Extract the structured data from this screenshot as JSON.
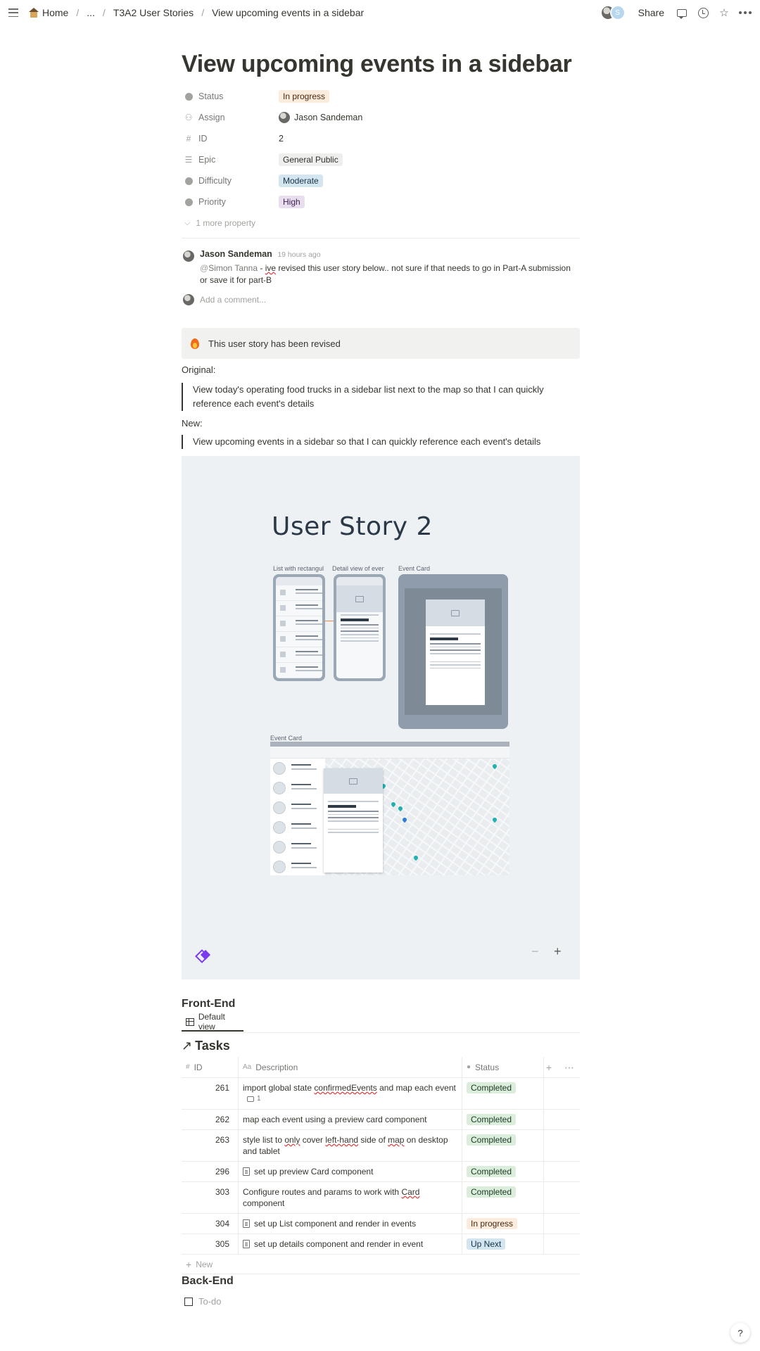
{
  "breadcrumb": {
    "home": "Home",
    "ellipsis": "...",
    "parent": "T3A2 User Stories",
    "current": "View upcoming events in a sidebar"
  },
  "topbar": {
    "share_label": "Share",
    "avatar2_initial": "S"
  },
  "page": {
    "title": "View upcoming events in a sidebar"
  },
  "properties": [
    {
      "icon": "status-icon",
      "name": "Status",
      "value": "In progress",
      "color": "#fbecdd"
    },
    {
      "icon": "person-icon",
      "name": "Assign",
      "value": "Jason Sandeman"
    },
    {
      "icon": "hash-icon",
      "name": "ID",
      "value": "2"
    },
    {
      "icon": "list-icon",
      "name": "Epic",
      "value": "General Public",
      "color": "#eeeeec"
    },
    {
      "icon": "select-icon",
      "name": "Difficulty",
      "value": "Moderate",
      "color": "#d3e5ef"
    },
    {
      "icon": "select-icon",
      "name": "Priority",
      "value": "High",
      "color": "#e8deee"
    }
  ],
  "more_property": "1 more property",
  "comment": {
    "author": "Jason Sandeman",
    "time": "19 hours ago",
    "mention": "Simon Tanna",
    "dash": " - ",
    "misspelled": "ive",
    "text": " revised this user story below.. not sure if that needs to go in Part-A submission or save it for part-B",
    "add_placeholder": "Add a comment..."
  },
  "callout": {
    "text": "This user story has been revised"
  },
  "original_label": "Original:",
  "original_quote": "View today's operating food trucks in a sidebar list next to the map so that I can quickly reference each event's details",
  "new_label": "New:",
  "new_quote": "View upcoming events in a sidebar so that I can quickly reference each event's details",
  "embed": {
    "title": "User Story 2",
    "frame_list": "List with rectangular",
    "frame_detail": "Detail view of event",
    "frame_event_card": "Event Card",
    "frame_event_card_web": "Event Card",
    "zoom_out": "−",
    "zoom_in": "+"
  },
  "frontend": {
    "heading": "Front-End",
    "view_label": "Default view",
    "db_title": "Tasks",
    "columns": {
      "id": "ID",
      "description": "Description",
      "status": "Status"
    },
    "rows": [
      {
        "id": "261",
        "description": "import global state confirmedEvents and map each event",
        "status": "Completed",
        "comments": "1",
        "doc": false
      },
      {
        "id": "262",
        "description": "map each event using a preview card component",
        "status": "Completed",
        "doc": false
      },
      {
        "id": "263",
        "description": "style list to only cover left-hand side of map on desktop and tablet",
        "status": "Completed",
        "doc": false
      },
      {
        "id": "296",
        "description": "set up preview Card component",
        "status": "Completed",
        "doc": true
      },
      {
        "id": "303",
        "description": "Configure routes and params to work with Card component",
        "status": "Completed",
        "doc": false
      },
      {
        "id": "304",
        "description": "set up List component and render in events",
        "status": "In progress",
        "doc": true
      },
      {
        "id": "305",
        "description": "set up details component and render in event",
        "status": "Up Next",
        "doc": true
      }
    ],
    "new_label": "New"
  },
  "backend": {
    "heading": "Back-End",
    "todo_placeholder": "To-do"
  },
  "help": "?",
  "colors": {
    "completed": "#dbeddb",
    "in_progress": "#fbecdd",
    "up_next": "#d3e5ef",
    "accent": "#7c3aed"
  }
}
